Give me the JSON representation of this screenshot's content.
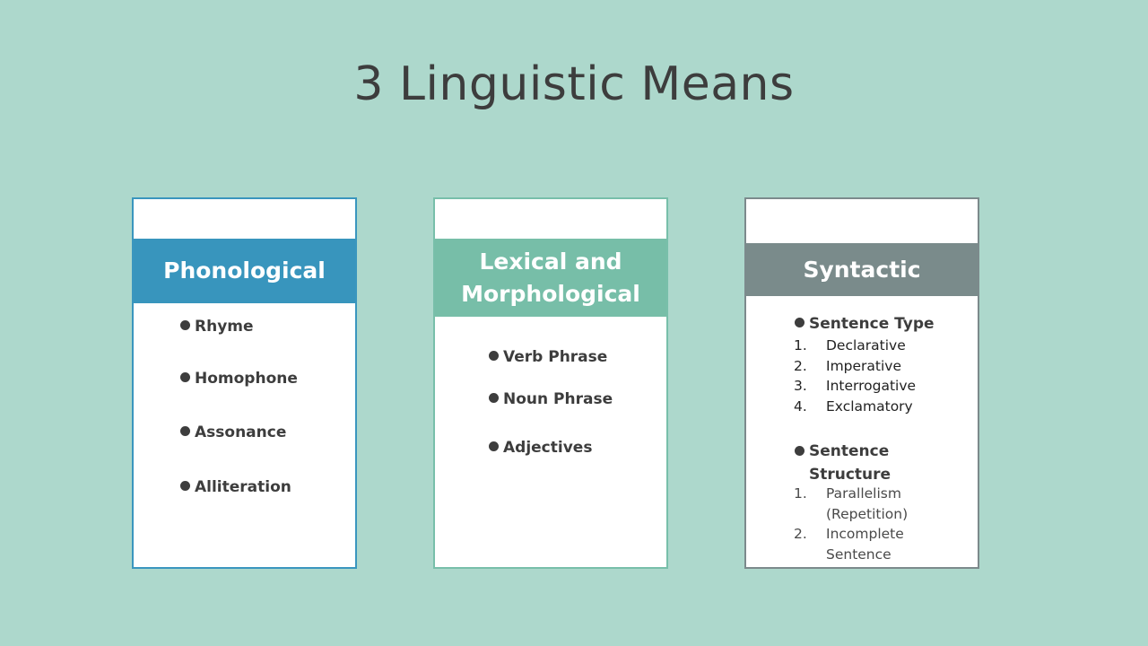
{
  "slide": {
    "title": "3 Linguistic Means",
    "cards": [
      {
        "header": "Phonological",
        "bullets": [
          "Rhyme",
          "Homophone",
          "Assonance",
          "Alliteration"
        ]
      },
      {
        "header": "Lexical and Morphological",
        "bullets": [
          "Verb Phrase",
          "Noun Phrase",
          "Adjectives"
        ]
      },
      {
        "header": "Syntactic",
        "sections": [
          {
            "heading": "Sentence Type",
            "items": [
              {
                "num": "1.",
                "text": "Declarative"
              },
              {
                "num": "2.",
                "text": "Imperative"
              },
              {
                "num": "3.",
                "text": "Interrogative"
              },
              {
                "num": "4.",
                "text": "Exclamatory"
              }
            ]
          },
          {
            "heading": "Sentence Structure",
            "items": [
              {
                "num": "1.",
                "text": "Parallelism (Repetition)"
              },
              {
                "num": "2.",
                "text": "Incomplete Sentence"
              }
            ]
          }
        ]
      }
    ]
  },
  "colors": {
    "background": "#add8cc",
    "phonological": "#3895bd",
    "lexical": "#77bea8",
    "syntactic": "#7a8b8b"
  }
}
